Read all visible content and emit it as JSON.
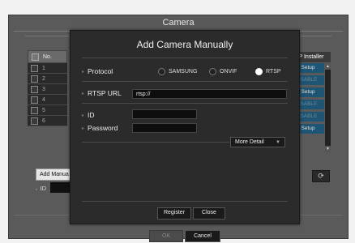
{
  "window": {
    "title": "Camera"
  },
  "table": {
    "header_no": "No.",
    "rows": [
      "1",
      "2",
      "3",
      "4",
      "5",
      "6"
    ]
  },
  "right_panel": {
    "header": "P Installer",
    "buttons": [
      "Setup",
      "ISABLE",
      "Setup",
      "ISABLE",
      "ISABLE",
      "Setup"
    ]
  },
  "bottom": {
    "add_manual_label": "Add Manua",
    "id_label": "ID",
    "ok_label": "OK",
    "cancel_label": "Cancel"
  },
  "dialog": {
    "title": "Add Camera Manually",
    "protocol_label": "Protocol",
    "protocol_options": [
      "SAMSUNG",
      "ONVIF",
      "RTSP"
    ],
    "protocol_selected": "RTSP",
    "rtsp_url_label": "RTSP URL",
    "rtsp_url_value": "rtsp://",
    "id_label": "ID",
    "id_value": "",
    "password_label": "Password",
    "password_value": "",
    "more_detail_label": "More Detail",
    "register_label": "Register",
    "close_label": "Close"
  }
}
